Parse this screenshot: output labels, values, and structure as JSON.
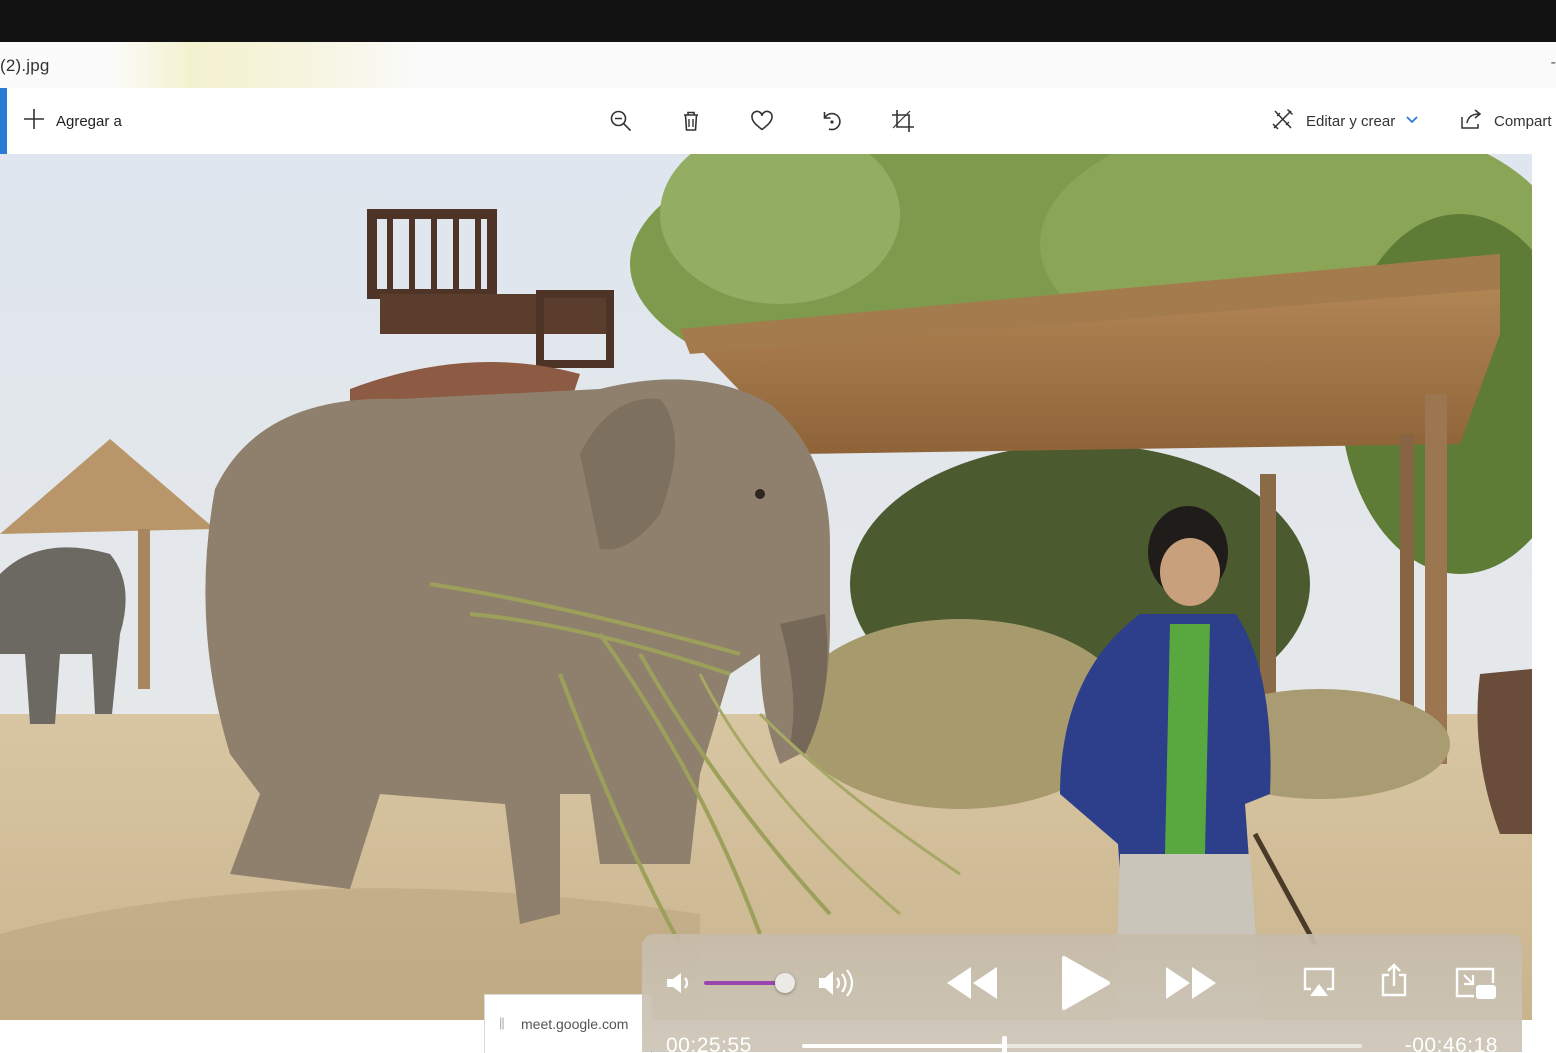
{
  "window": {
    "filename": "(2).jpg",
    "title_right_glyph": "-"
  },
  "toolbar": {
    "add_label": "Agregar a",
    "icons": [
      "zoom-out-icon",
      "delete-icon",
      "favorite-heart-icon",
      "rotate-icon",
      "crop-icon"
    ],
    "edit_label": "Editar y crear",
    "share_label": "Compart"
  },
  "browser_tab": {
    "url_text": "meet.google.com"
  },
  "player": {
    "elapsed": "00:25:55",
    "remaining": "-00:46:18",
    "progress_fraction": 0.36,
    "volume_fraction": 0.9,
    "accent_color": "#9a44ad",
    "controls": [
      "volume-low-icon",
      "volume-high-icon",
      "rewind-icon",
      "play-icon",
      "fast-forward-icon",
      "airplay-icon",
      "share-icon",
      "picture-in-picture-icon"
    ]
  }
}
